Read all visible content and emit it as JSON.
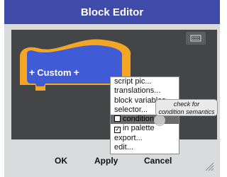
{
  "window": {
    "title": "Block Editor"
  },
  "block": {
    "label": "Custom",
    "left_symbol": "+",
    "right_symbol": "+",
    "color": "#f2a623",
    "body_color": "#3f5bd6"
  },
  "context_menu": {
    "items": [
      {
        "label": "script pic...",
        "checkbox": null
      },
      {
        "label": "translations...",
        "checkbox": null
      },
      {
        "label": "block variables...",
        "checkbox": null
      },
      {
        "label": "selector...",
        "checkbox": null
      },
      {
        "label": "condition",
        "checkbox": "unchecked",
        "highlighted": true
      },
      {
        "label": "in palette",
        "checkbox": "checked"
      },
      {
        "label": "export...",
        "checkbox": null
      },
      {
        "label": "edit...",
        "checkbox": null
      }
    ]
  },
  "tooltip": {
    "line1": "check for",
    "line2": "condition semantics"
  },
  "buttons": {
    "ok": "OK",
    "apply": "Apply",
    "cancel": "Cancel"
  },
  "icons": {
    "keyboard": "keyboard-icon",
    "resize": "resize-handle-icon"
  }
}
